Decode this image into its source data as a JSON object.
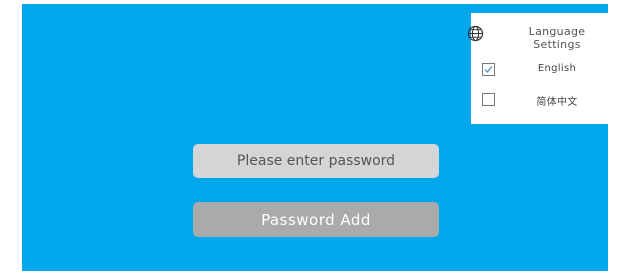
{
  "password": {
    "placeholder": "Please enter password",
    "value": ""
  },
  "add_button": {
    "label": "Password Add"
  },
  "language_settings": {
    "title_line1": "Language",
    "title_line2": "Settings",
    "icon": "globe-icon",
    "options": [
      {
        "label": "English",
        "checked": true
      },
      {
        "label": "简体中文",
        "checked": false
      }
    ]
  },
  "colors": {
    "background": "#00a7ec",
    "input_bg": "#d3d5d6",
    "button_bg": "#a8aaab",
    "check_accent": "#3a8fd6"
  }
}
